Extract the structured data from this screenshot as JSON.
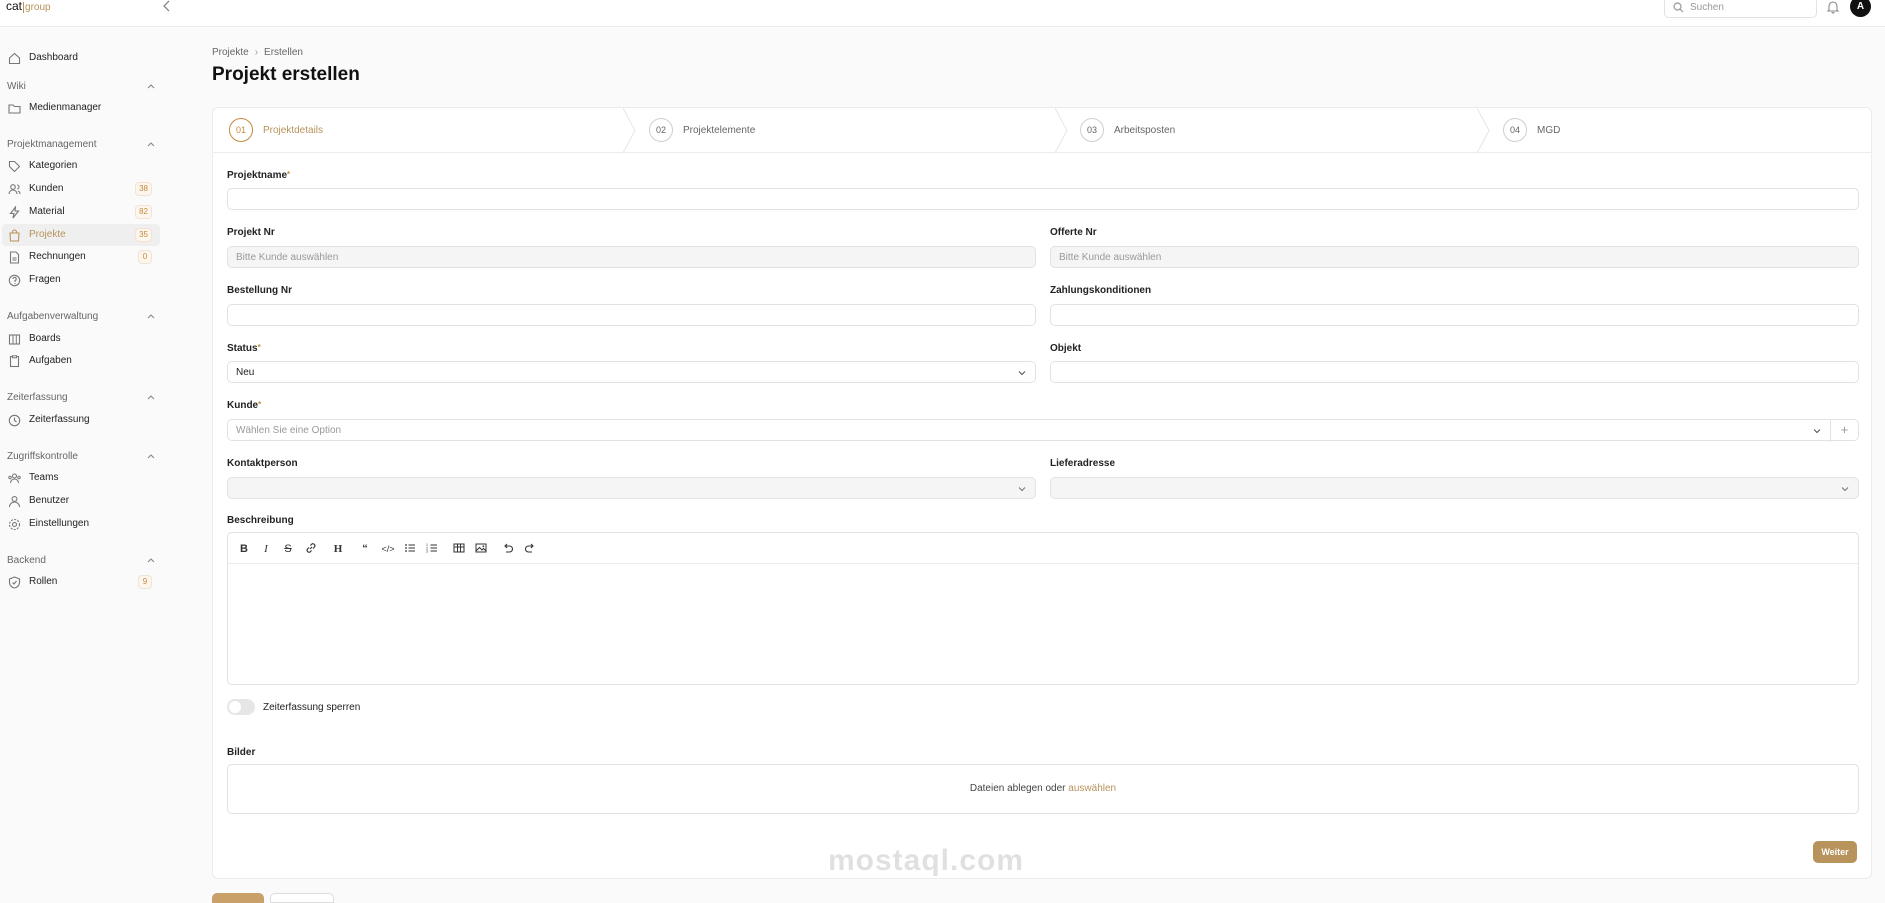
{
  "app": {
    "logo_main": "cat",
    "logo_sub": "group"
  },
  "topbar": {
    "search_placeholder": "Suchen",
    "avatar_initial": "A"
  },
  "sidebar": {
    "dashboard": "Dashboard",
    "sections": [
      {
        "title": "Wiki",
        "items": [
          {
            "label": "Medienmanager",
            "icon": "folder-icon"
          }
        ]
      },
      {
        "title": "Projektmanagement",
        "items": [
          {
            "label": "Kategorien",
            "icon": "tag-icon"
          },
          {
            "label": "Kunden",
            "icon": "users-icon",
            "count": "38"
          },
          {
            "label": "Material",
            "icon": "bolt-icon",
            "count": "82"
          },
          {
            "label": "Projekte",
            "icon": "shopping-bag-icon",
            "count": "35",
            "active": true
          },
          {
            "label": "Rechnungen",
            "icon": "document-icon",
            "count": "0"
          },
          {
            "label": "Fragen",
            "icon": "question-icon"
          }
        ]
      },
      {
        "title": "Aufgabenverwaltung",
        "items": [
          {
            "label": "Boards",
            "icon": "columns-icon"
          },
          {
            "label": "Aufgaben",
            "icon": "tasks-icon"
          }
        ]
      },
      {
        "title": "Zeiterfassung",
        "items": [
          {
            "label": "Zeiterfassung",
            "icon": "clock-icon"
          }
        ]
      },
      {
        "title": "Zugriffskontrolle",
        "items": [
          {
            "label": "Teams",
            "icon": "team-icon"
          },
          {
            "label": "Benutzer",
            "icon": "user-icon"
          },
          {
            "label": "Einstellungen",
            "icon": "gear-icon"
          }
        ]
      },
      {
        "title": "Backend",
        "items": [
          {
            "label": "Rollen",
            "icon": "shield-icon",
            "count": "9"
          }
        ]
      }
    ]
  },
  "breadcrumb": {
    "parent": "Projekte",
    "current": "Erstellen"
  },
  "page_title": "Projekt erstellen",
  "steps": [
    {
      "num": "01",
      "label": "Projektdetails",
      "current": true
    },
    {
      "num": "02",
      "label": "Projektelemente"
    },
    {
      "num": "03",
      "label": "Arbeitsposten"
    },
    {
      "num": "04",
      "label": "MGD"
    }
  ],
  "form": {
    "projektname": {
      "label": "Projektname",
      "value": ""
    },
    "projekt_nr": {
      "label": "Projekt Nr",
      "placeholder": "Bitte Kunde auswählen"
    },
    "offerte_nr": {
      "label": "Offerte Nr",
      "placeholder": "Bitte Kunde auswählen"
    },
    "bestellung_nr": {
      "label": "Bestellung Nr",
      "value": ""
    },
    "zahlungskonditionen": {
      "label": "Zahlungskonditionen",
      "value": ""
    },
    "status": {
      "label": "Status",
      "value": "Neu"
    },
    "objekt": {
      "label": "Objekt",
      "value": ""
    },
    "kunde": {
      "label": "Kunde",
      "placeholder": "Wählen Sie eine Option"
    },
    "kontaktperson": {
      "label": "Kontaktperson",
      "value": ""
    },
    "lieferadresse": {
      "label": "Lieferadresse",
      "value": ""
    },
    "beschreibung": {
      "label": "Beschreibung"
    },
    "zeiterfassung_toggle": {
      "label": "Zeiterfassung sperren",
      "on": false
    },
    "bilder": {
      "label": "Bilder",
      "drop_text": "Dateien ablegen oder",
      "drop_link": "auswählen"
    }
  },
  "buttons": {
    "next": "Weiter"
  },
  "watermark": {
    "text": "mostaql.com"
  },
  "colors": {
    "accent": "#b8935c",
    "badge_text": "#c48a3c"
  }
}
